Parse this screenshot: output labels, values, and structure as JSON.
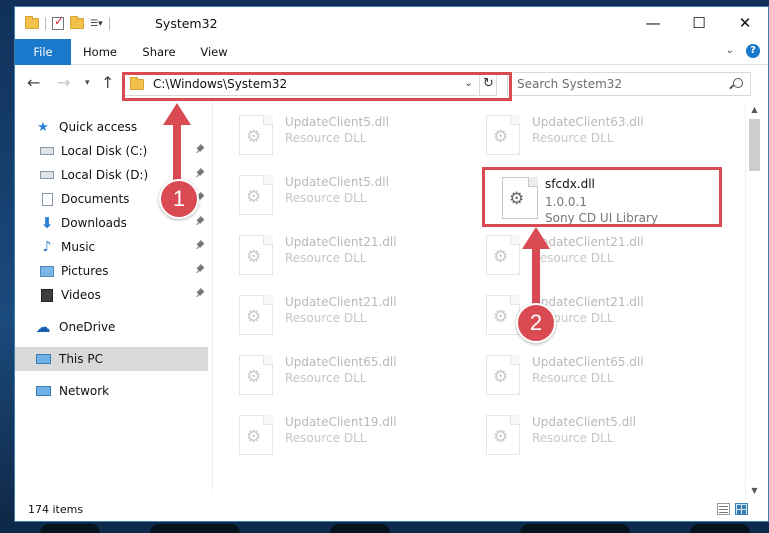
{
  "window": {
    "title": "System32"
  },
  "ribbon": {
    "tabs": [
      "File",
      "Home",
      "Share",
      "View"
    ]
  },
  "address": {
    "path": "C:\\Windows\\System32"
  },
  "search": {
    "placeholder": "Search System32"
  },
  "nav": {
    "items": [
      {
        "label": "Quick access",
        "icon": "star-icon",
        "pinned": false
      },
      {
        "label": "Local Disk (C:)",
        "icon": "drive-icon",
        "pinned": true
      },
      {
        "label": "Local Disk (D:)",
        "icon": "drive-icon",
        "pinned": true
      },
      {
        "label": "Documents",
        "icon": "documents-icon",
        "pinned": true
      },
      {
        "label": "Downloads",
        "icon": "download-icon",
        "pinned": true
      },
      {
        "label": "Music",
        "icon": "music-icon",
        "pinned": true
      },
      {
        "label": "Pictures",
        "icon": "pictures-icon",
        "pinned": true
      },
      {
        "label": "Videos",
        "icon": "videos-icon",
        "pinned": true
      },
      {
        "label": "OneDrive",
        "icon": "cloud-icon",
        "pinned": false
      },
      {
        "label": "This PC",
        "icon": "computer-icon",
        "pinned": false,
        "selected": true
      },
      {
        "label": "Network",
        "icon": "network-icon",
        "pinned": false
      }
    ]
  },
  "files": {
    "left": [
      {
        "name": "UpdateClient5.dll",
        "type": "Resource DLL"
      },
      {
        "name": "UpdateClient5.dll",
        "type": "Resource DLL"
      },
      {
        "name": "UpdateClient21.dll",
        "type": "Resource DLL"
      },
      {
        "name": "UpdateClient21.dll",
        "type": "Resource DLL"
      },
      {
        "name": "UpdateClient65.dll",
        "type": "Resource DLL"
      },
      {
        "name": "UpdateClient19.dll",
        "type": "Resource DLL"
      }
    ],
    "right": [
      {
        "name": "UpdateClient63.dll",
        "type": "Resource DLL"
      },
      {
        "name": "UpdateClient21.dll",
        "type": "Resource DLL"
      },
      {
        "name": "UpdateClient21.dll",
        "type": "Resource DLL"
      },
      {
        "name": "UpdateClient65.dll",
        "type": "Resource DLL"
      },
      {
        "name": "UpdateClient5.dll",
        "type": "Resource DLL"
      }
    ],
    "highlighted": {
      "name": "sfcdx.dll",
      "version": "1.0.0.1",
      "description": "Sony CD UI Library"
    }
  },
  "status": {
    "item_count": "174 items"
  },
  "annotations": {
    "step1": "1",
    "step2": "2",
    "color": "#d94a52"
  }
}
